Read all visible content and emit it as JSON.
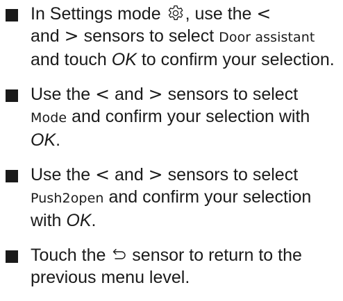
{
  "steps": [
    {
      "t1": "In Settings mode ",
      "icon": "gear-icon",
      "t2": ", use the ",
      "lt": "<",
      "t3": "and ",
      "gt": ">",
      "t4": " sensors to select ",
      "display": "Door assistant",
      "t5": "and touch ",
      "ok": "OK",
      "t6": " to confirm your selection."
    },
    {
      "t1": "Use the ",
      "lt": "<",
      "t2": " and ",
      "gt": ">",
      "t3": " sensors to select ",
      "display": "Mode",
      "t4": " and confirm your selection with ",
      "ok": "OK",
      "t5": "."
    },
    {
      "t1": "Use the ",
      "lt": "<",
      "t2": " and ",
      "gt": ">",
      "t3": " sensors to select ",
      "display": "Push2open",
      "t4": " and confirm your selection with ",
      "ok": "OK",
      "t5": "."
    },
    {
      "t1": "Touch the ",
      "icon": "back-arrow-icon",
      "t2": " sensor to return to the previous menu level."
    }
  ]
}
